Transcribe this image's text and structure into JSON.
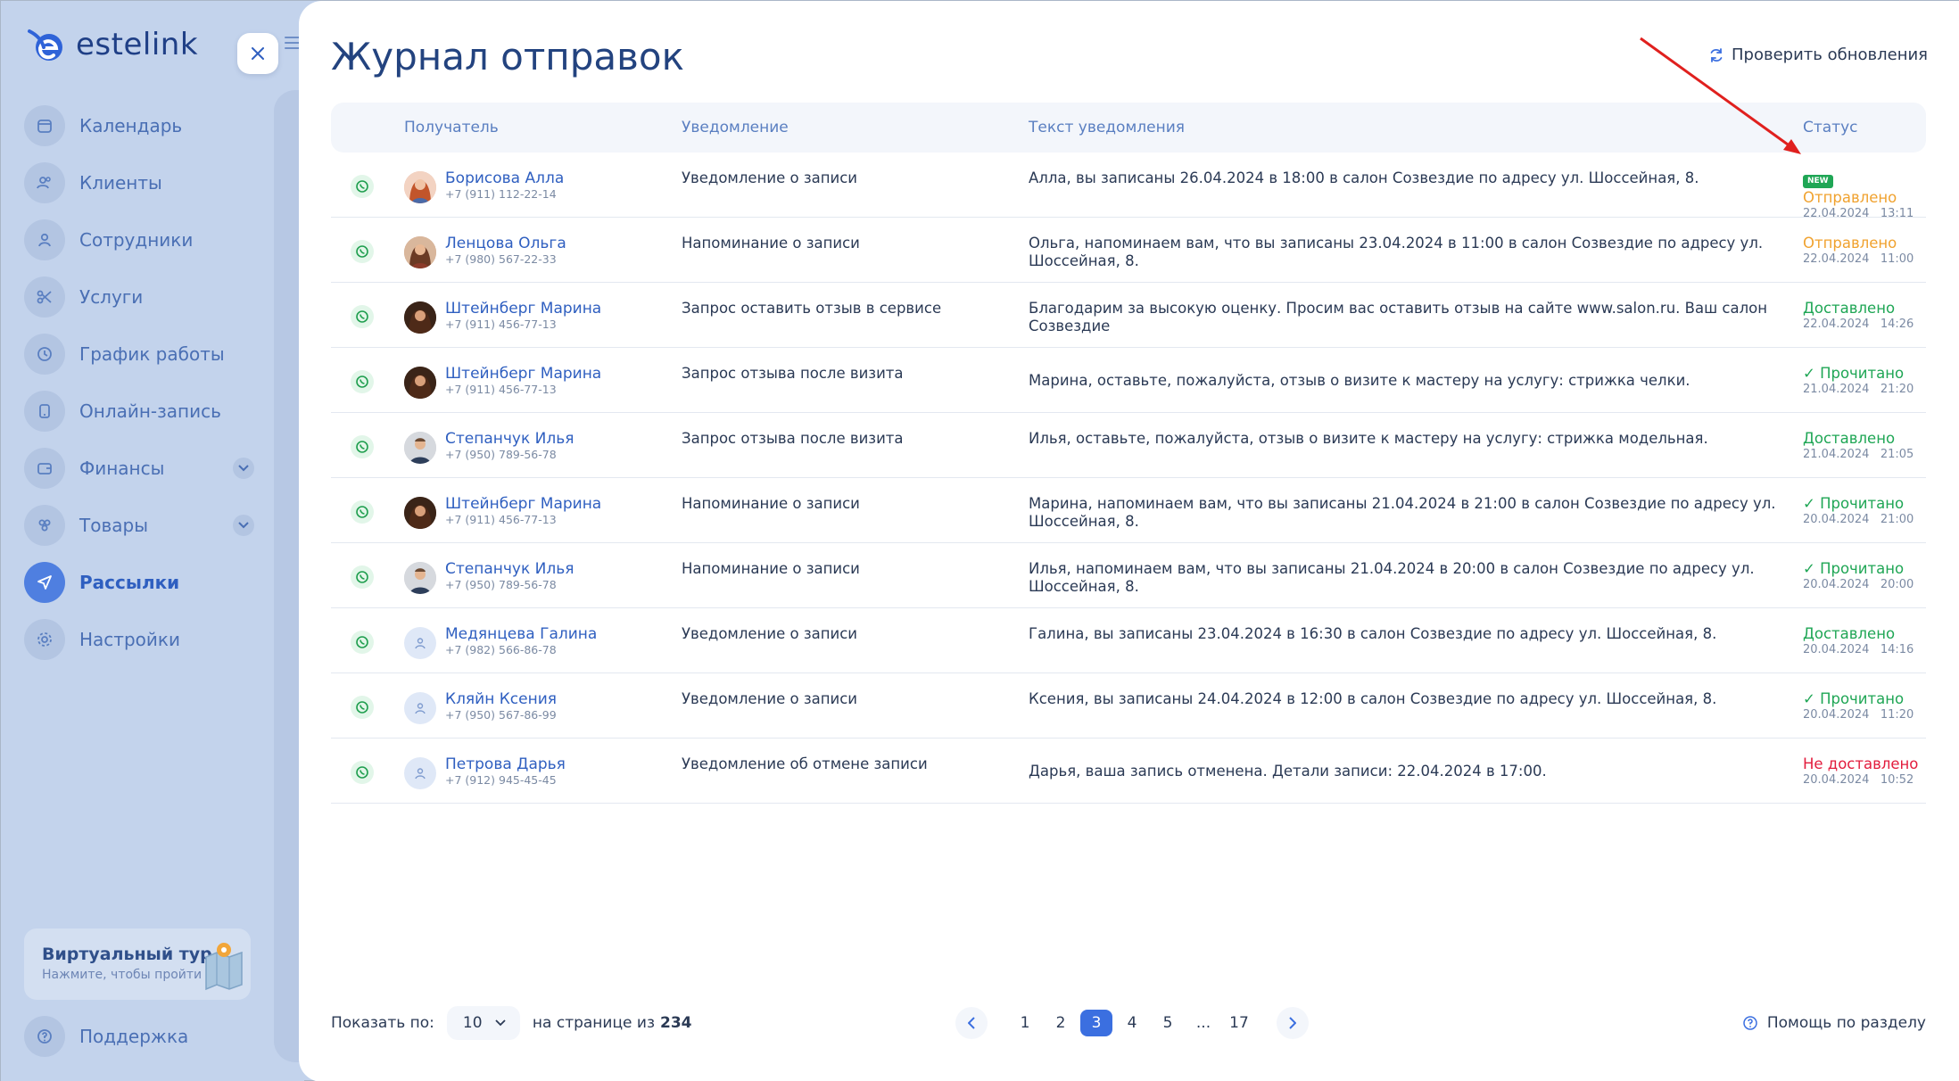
{
  "app": {
    "logo_text": "estelink"
  },
  "sidebar": {
    "items": [
      {
        "label": "Календарь",
        "icon": "calendar-icon"
      },
      {
        "label": "Клиенты",
        "icon": "clients-icon"
      },
      {
        "label": "Сотрудники",
        "icon": "user-icon"
      },
      {
        "label": "Услуги",
        "icon": "scissors-icon"
      },
      {
        "label": "График работы",
        "icon": "clock-icon"
      },
      {
        "label": "Онлайн-запись",
        "icon": "phone-icon"
      },
      {
        "label": "Финансы",
        "icon": "wallet-icon"
      },
      {
        "label": "Товары",
        "icon": "box-icon"
      },
      {
        "label": "Рассылки",
        "icon": "send-icon"
      },
      {
        "label": "Настройки",
        "icon": "gear-icon"
      }
    ],
    "tour": {
      "title": "Виртуальный тур",
      "subtitle": "Нажмите, чтобы пройти"
    },
    "support": "Поддержка"
  },
  "header": {
    "title": "Журнал отправок",
    "check_updates": "Проверить обновления"
  },
  "table": {
    "columns": {
      "recipient": "Получатель",
      "notification": "Уведомление",
      "text": "Текст уведомления",
      "status": "Статус"
    },
    "new_badge": "NEW",
    "rows": [
      {
        "name": "Борисова Алла",
        "phone": "+7 (911) 112-22-14",
        "type": "Уведомление о записи",
        "text": "Алла, вы записаны 26.04.2024 в 18:00 в салон Созвездие по адресу ул. Шоссейная, 8.",
        "status": "Отправлено",
        "date": "22.04.2024   13:11"
      },
      {
        "name": "Ленцова Ольга",
        "phone": "+7 (980) 567-22-33",
        "type": "Напоминание о записи",
        "text": "Ольга, напоминаем вам, что вы записаны 23.04.2024 в 11:00 в салон Созвездие по адресу ул. Шоссейная, 8.",
        "status": "Отправлено",
        "date": "22.04.2024   11:00"
      },
      {
        "name": "Штейнберг Марина",
        "phone": "+7 (911) 456-77-13",
        "type": "Запрос оставить отзыв в сервисе",
        "text": "Благодарим за высокую оценку. Просим вас оставить отзыв на сайте www.salon.ru. Ваш салон Созвездие",
        "status": "Доставлено",
        "date": "22.04.2024   14:26"
      },
      {
        "name": "Штейнберг Марина",
        "phone": "+7 (911) 456-77-13",
        "type": "Запрос отзыва после визита",
        "text": "Марина, оставьте, пожалуйста, отзыв о визите к мастеру на услугу: стрижка челки.",
        "status": "✓ Прочитано",
        "date": "21.04.2024   21:20"
      },
      {
        "name": "Степанчук Илья",
        "phone": "+7 (950) 789-56-78",
        "type": "Запрос отзыва после визита",
        "text": "Илья, оставьте, пожалуйста, отзыв о визите к мастеру на услугу: стрижка модельная.",
        "status": "Доставлено",
        "date": "21.04.2024   21:05"
      },
      {
        "name": "Штейнберг Марина",
        "phone": "+7 (911) 456-77-13",
        "type": "Напоминание о записи",
        "text": "Марина, напоминаем вам, что вы записаны 21.04.2024 в 21:00 в салон Созвездие по адресу ул. Шоссейная, 8.",
        "status": "✓ Прочитано",
        "date": "20.04.2024   21:00"
      },
      {
        "name": "Степанчук Илья",
        "phone": "+7 (950) 789-56-78",
        "type": "Напоминание о записи",
        "text": "Илья, напоминаем вам, что вы записаны 21.04.2024 в 20:00 в салон Созвездие по адресу ул. Шоссейная, 8.",
        "status": "✓ Прочитано",
        "date": "20.04.2024   20:00"
      },
      {
        "name": "Медянцева Галина",
        "phone": "+7 (982) 566-86-78",
        "type": "Уведомление о записи",
        "text": "Галина, вы записаны 23.04.2024 в 16:30 в салон Созвездие по адресу ул. Шоссейная, 8.",
        "status": "Доставлено",
        "date": "20.04.2024   14:16"
      },
      {
        "name": "Кляйн Ксения",
        "phone": "+7 (950) 567-86-99",
        "type": "Уведомление о записи",
        "text": "Ксения, вы записаны 24.04.2024 в 12:00 в салон Созвездие по адресу ул. Шоссейная, 8.",
        "status": "✓ Прочитано",
        "date": "20.04.2024   11:20"
      },
      {
        "name": "Петрова Дарья",
        "phone": "+7 (912) 945-45-45",
        "type": "Уведомление об отмене записи",
        "text": "Дарья, ваша запись отменена. Детали записи: 22.04.2024 в 17:00.",
        "status": "Не доставлено",
        "date": "20.04.2024   10:52"
      }
    ]
  },
  "footer": {
    "show_label": "Показать по:",
    "per_page": "10",
    "of_label": "на странице из",
    "total": "234",
    "pages": [
      "1",
      "2",
      "3",
      "4",
      "5",
      "...",
      "17"
    ],
    "help": "Помощь по разделу"
  },
  "colors": {
    "accent": "#3b6fe0",
    "sent": "#f0a22f",
    "delivered": "#1fa655",
    "failed": "#e21c3d",
    "annotation_arrow": "#e0201e"
  }
}
